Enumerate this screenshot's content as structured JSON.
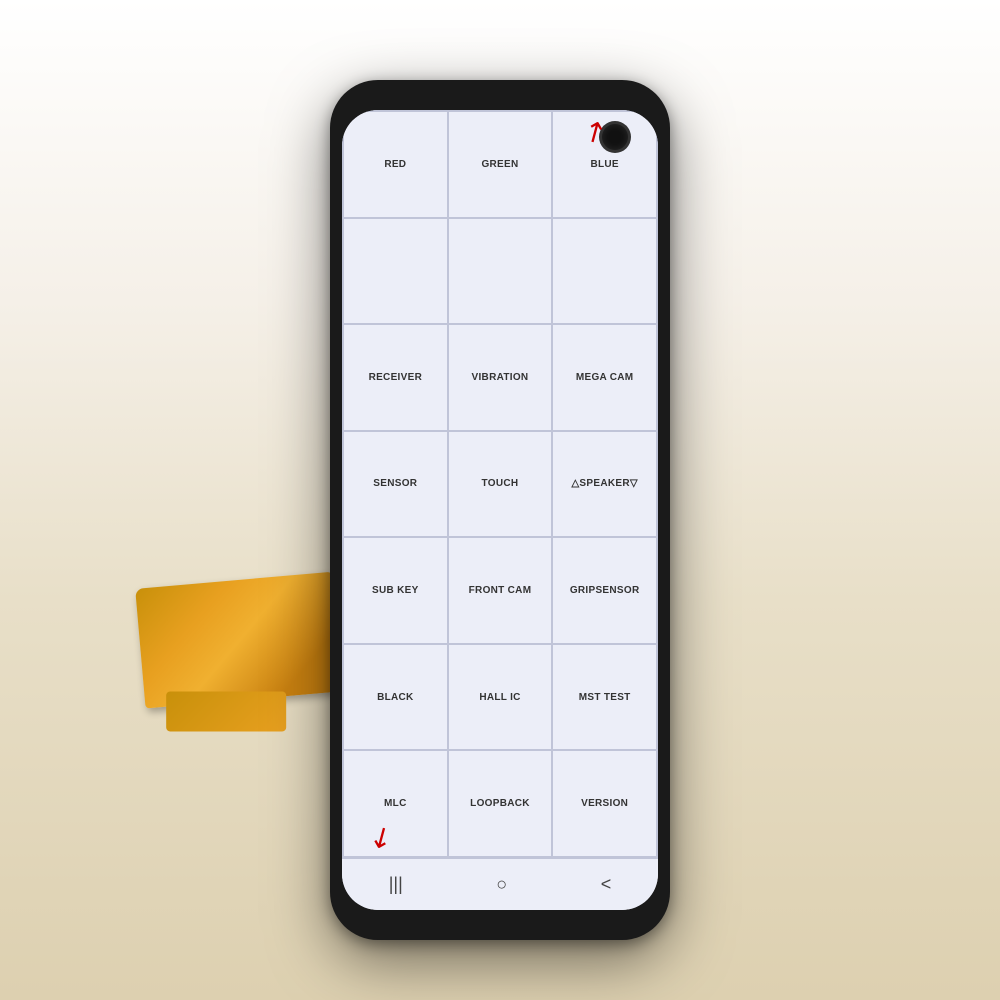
{
  "background": {
    "color": "#f0ede8"
  },
  "phone": {
    "screen_color": "#e8eaf6",
    "grid": {
      "rows": [
        [
          {
            "label": "RED",
            "id": "red"
          },
          {
            "label": "GREEN",
            "id": "green"
          },
          {
            "label": "BLUE",
            "id": "blue"
          }
        ],
        [
          {
            "label": "",
            "id": "empty1"
          },
          {
            "label": "",
            "id": "empty2"
          },
          {
            "label": "",
            "id": "empty3"
          }
        ],
        [
          {
            "label": "RECEIVER",
            "id": "receiver"
          },
          {
            "label": "VIBRATION",
            "id": "vibration"
          },
          {
            "label": "MEGA CAM",
            "id": "mega-cam"
          }
        ],
        [
          {
            "label": "SENSOR",
            "id": "sensor"
          },
          {
            "label": "TOUCH",
            "id": "touch"
          },
          {
            "label": "△SPEAKER▽",
            "id": "speaker"
          }
        ],
        [
          {
            "label": "SUB KEY",
            "id": "sub-key"
          },
          {
            "label": "FRONT CAM",
            "id": "front-cam"
          },
          {
            "label": "GRIPSENSOR",
            "id": "gripsensor"
          }
        ],
        [
          {
            "label": "BLACK",
            "id": "black"
          },
          {
            "label": "HALL IC",
            "id": "hall-ic"
          },
          {
            "label": "MST TEST",
            "id": "mst-test"
          }
        ],
        [
          {
            "label": "MLC",
            "id": "mlc"
          },
          {
            "label": "LOOPBACK",
            "id": "loopback"
          },
          {
            "label": "VERSION",
            "id": "version"
          }
        ]
      ]
    },
    "nav": {
      "recent_icon": "|||",
      "home_icon": "○",
      "back_icon": "<"
    }
  }
}
